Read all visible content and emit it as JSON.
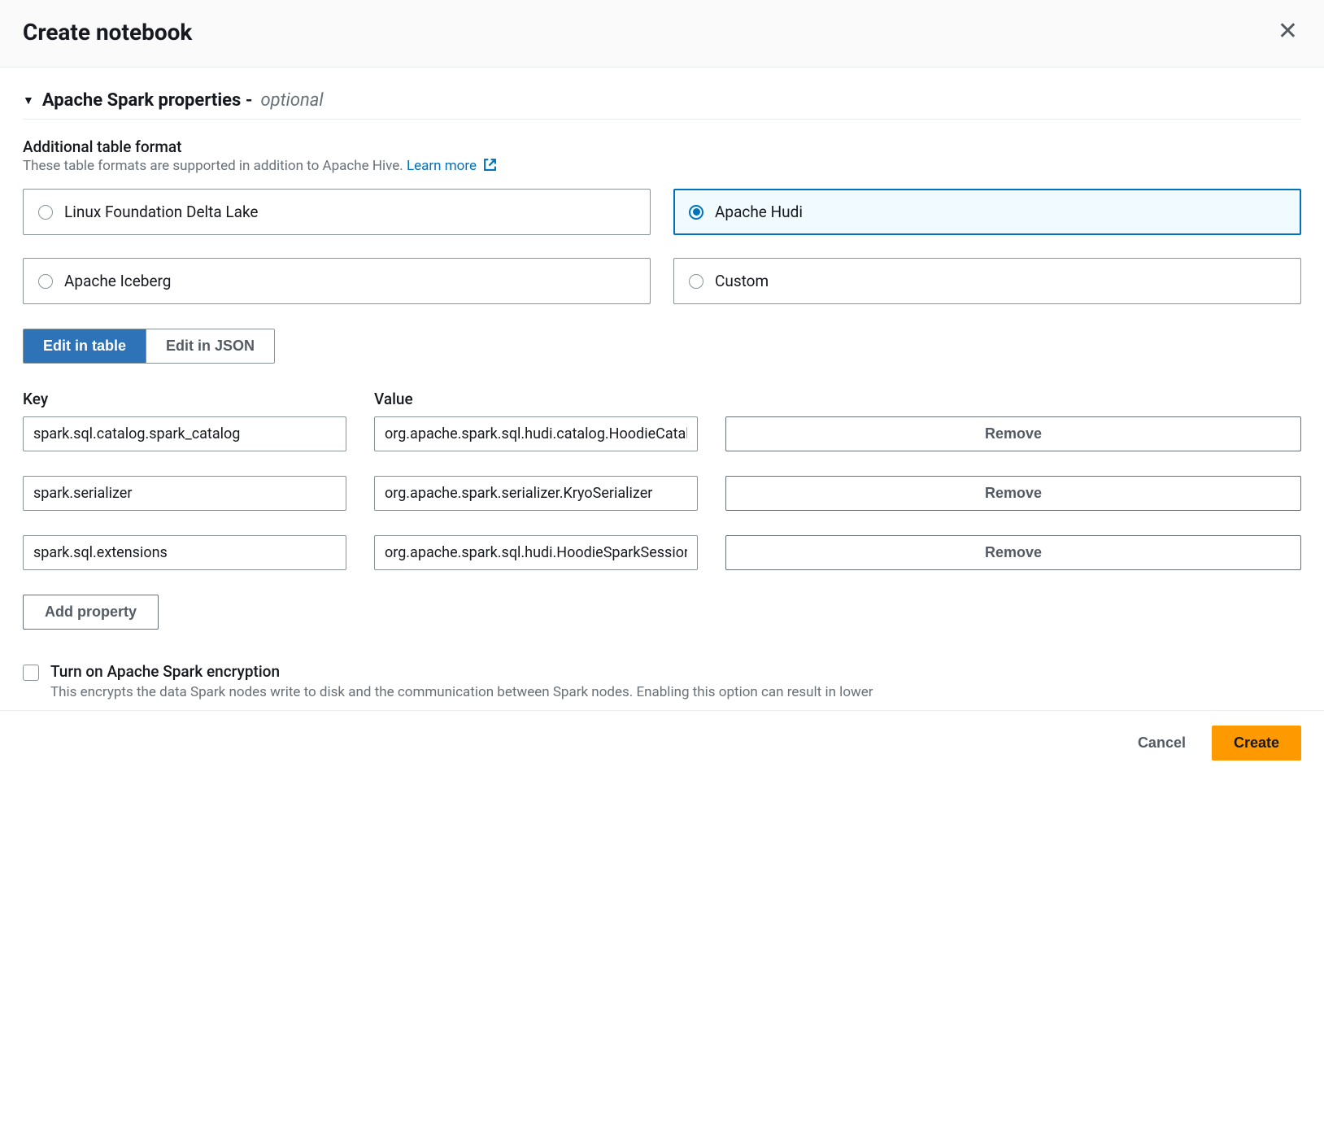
{
  "header": {
    "title": "Create notebook"
  },
  "section": {
    "title": "Apache Spark properties -",
    "optional": "optional"
  },
  "tableFormat": {
    "label": "Additional table format",
    "description": "These table formats are supported in addition to Apache Hive.",
    "learnMore": "Learn more",
    "options": [
      {
        "label": "Linux Foundation Delta Lake",
        "selected": false
      },
      {
        "label": "Apache Hudi",
        "selected": true
      },
      {
        "label": "Apache Iceberg",
        "selected": false
      },
      {
        "label": "Custom",
        "selected": false
      }
    ]
  },
  "editToggle": {
    "table": "Edit in table",
    "json": "Edit in JSON"
  },
  "props": {
    "keyHeader": "Key",
    "valueHeader": "Value",
    "removeLabel": "Remove",
    "rows": [
      {
        "key": "spark.sql.catalog.spark_catalog",
        "value": "org.apache.spark.sql.hudi.catalog.HoodieCatalog"
      },
      {
        "key": "spark.serializer",
        "value": "org.apache.spark.serializer.KryoSerializer"
      },
      {
        "key": "spark.sql.extensions",
        "value": "org.apache.spark.sql.hudi.HoodieSparkSessionExtension"
      }
    ],
    "addLabel": "Add property"
  },
  "encryption": {
    "label": "Turn on Apache Spark encryption",
    "description": "This encrypts the data Spark nodes write to disk and the communication between Spark nodes. Enabling this option can result in lower"
  },
  "footer": {
    "cancel": "Cancel",
    "create": "Create"
  }
}
